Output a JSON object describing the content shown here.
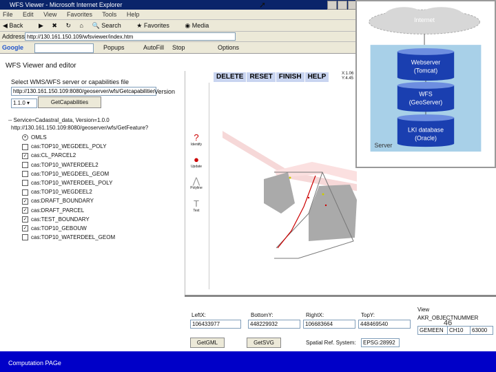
{
  "window": {
    "title": "WFS Viewer - Microsoft Internet Explorer"
  },
  "menu": [
    "File",
    "Edit",
    "View",
    "Favorites",
    "Tools",
    "Help"
  ],
  "toolbar": {
    "back": "Back",
    "search": "Search",
    "favorites": "Favorites",
    "media": "Media"
  },
  "address": {
    "label": "Address",
    "value": "http://130.161.150.109/wfsviewer/index.htm"
  },
  "googlebar": {
    "label": "Google",
    "popups": "Popups",
    "options": "Options",
    "autofill": "AutoFill",
    "stop": "Stop"
  },
  "page": {
    "title": "WFS Viewer and editor",
    "select_label": "Select WMS/WFS server or capabilities file",
    "cap_url": "http://130.161.150.109:8080/geoserver/wfs/Getcapabilities",
    "version_label": "Version",
    "version_value": "1.1.0",
    "getcap_button": "GetCapabilities",
    "service_title": "-- Service=Cadastral_data, Version=1.0.0",
    "service_url": "http://130.161.150.109:8080/geoserver/wfs/GetFeature?",
    "layers": [
      {
        "label": "OMLS",
        "type": "radio",
        "checked": true
      },
      {
        "label": "cas:TOP10_WEGDEEL_POLY",
        "type": "check",
        "checked": false
      },
      {
        "label": "cas:CL_PARCEL2",
        "type": "check",
        "checked": true
      },
      {
        "label": "cas:TOP10_WATERDEEL2",
        "type": "check",
        "checked": false
      },
      {
        "label": "cas:TOP10_WEGDEEL_GEOM",
        "type": "check",
        "checked": false
      },
      {
        "label": "cas:TOP10_WATERDEEL_POLY",
        "type": "check",
        "checked": false
      },
      {
        "label": "cas:TOP10_WEGDEEL2",
        "type": "check",
        "checked": false
      },
      {
        "label": "cas:DRAFT_BOUNDARY",
        "type": "check",
        "checked": true
      },
      {
        "label": "cas:DRAFT_PARCEL",
        "type": "check",
        "checked": true
      },
      {
        "label": "cas:TEST_BOUNDARY",
        "type": "check",
        "checked": true
      },
      {
        "label": "cas:TOP10_GEBOUW",
        "type": "check",
        "checked": true
      },
      {
        "label": "cas:TOP10_WATERDEEL_GEOM",
        "type": "check",
        "checked": false
      }
    ]
  },
  "map_toolbar": {
    "delete": "DELETE",
    "reset": "RESET",
    "finish": "FINISH",
    "help": "HELP"
  },
  "coords": {
    "x": "X:1.06",
    "y": "Y:4.45"
  },
  "tools": {
    "identify": "Identify",
    "update": "Update",
    "polyline": "Polyline",
    "text": "Text"
  },
  "bottom": {
    "left_x_label": "LeftX:",
    "left_x": "106433977",
    "bottom_y_label": "BottomY:",
    "bottom_y": "448229932",
    "right_x_label": "RightX:",
    "right_x": "106683664",
    "top_y_label": "TopY:",
    "top_y": "448469540",
    "view_label": "View",
    "view_value": "AKR_OBJECTNUMMER",
    "getgml_button": "GetGML",
    "getsvg_button": "GetSVG",
    "srs_label": "Spatial Ref. System:",
    "srs_value": "EPSG:28992",
    "gemeente": "GEMEEN",
    "sectie": "CH10",
    "nummer": "63000"
  },
  "status": {
    "text": "Computation PAGe"
  },
  "slide_number": "46",
  "diagram": {
    "internet": "Internet",
    "webserver": "Webserver",
    "webserver_sub": "(Tomcat)",
    "wfs": "WFS",
    "wfs_sub": "(GeoServer)",
    "db": "LKI database",
    "db_sub": "(Oracle)",
    "server": "Server",
    "colors": {
      "cloud": "#d7d7d7",
      "server_bg": "#a8d0e8",
      "cylinder": "#1a3fb0",
      "cylinder_top": "#6d8ee0"
    }
  }
}
